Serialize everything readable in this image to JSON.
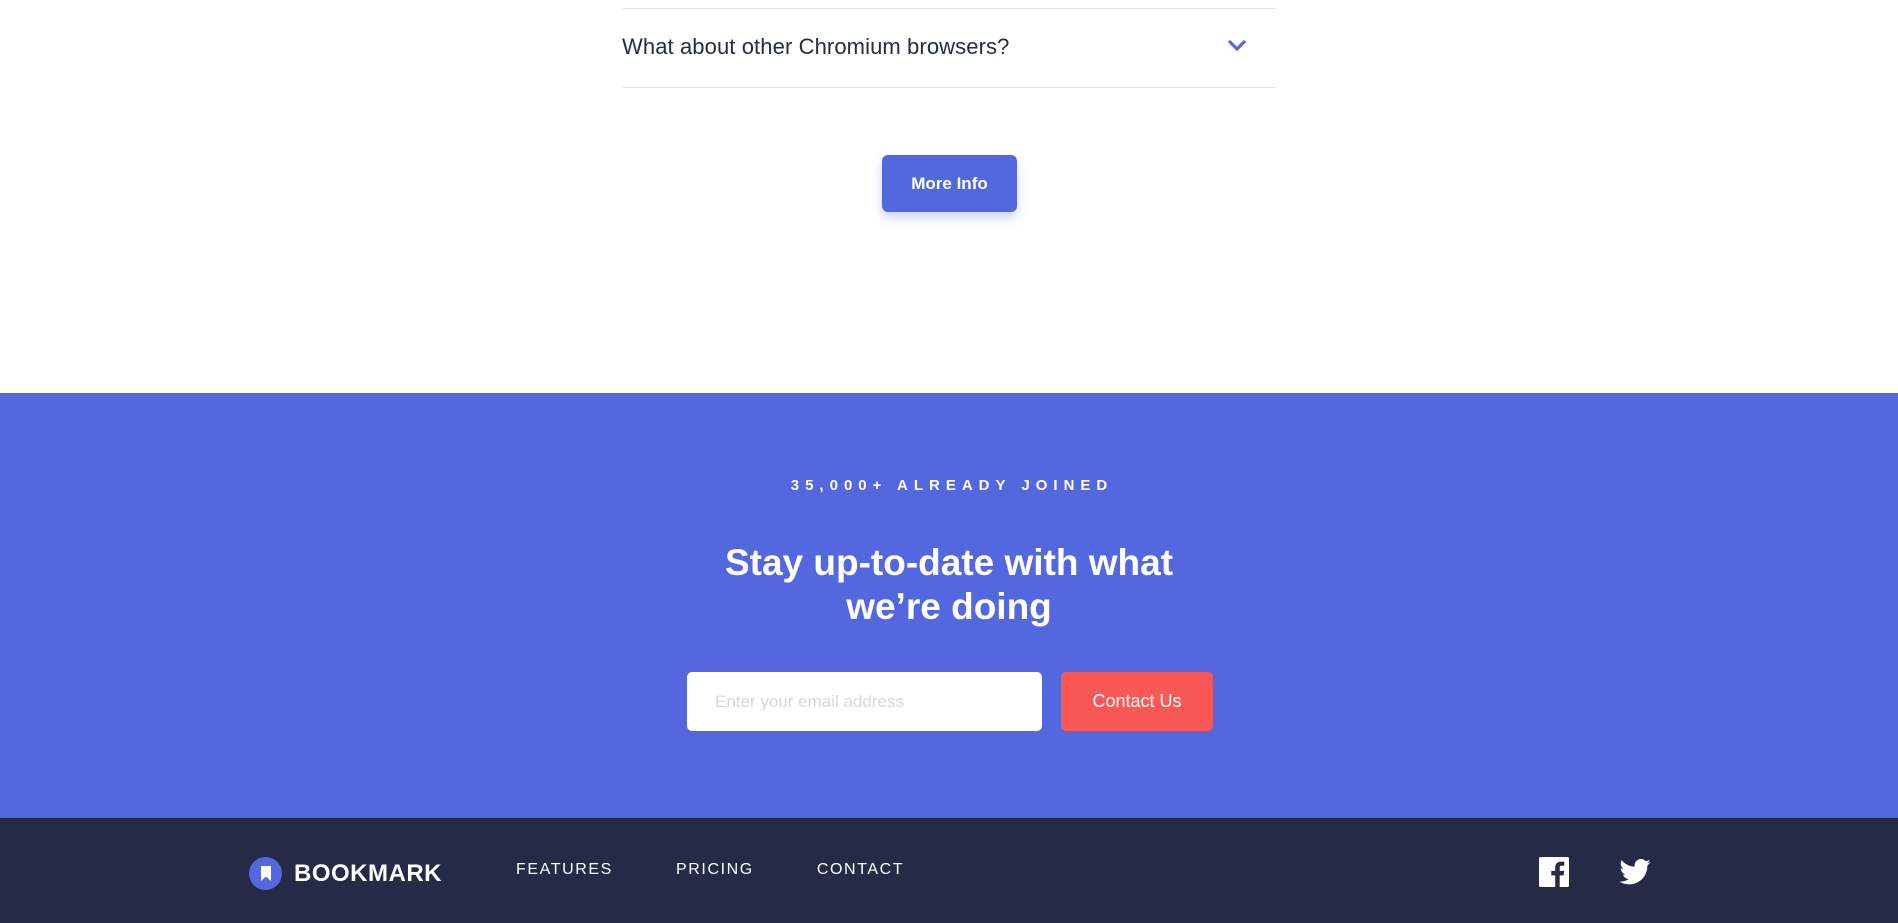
{
  "faq": {
    "question": "What about other Chromium browsers?",
    "more_info_label": "More Info"
  },
  "newsletter": {
    "kicker": "35,000+ ALREADY JOINED",
    "title": "Stay up-to-date with what we’re doing",
    "email_placeholder": "Enter your email address",
    "contact_label": "Contact Us"
  },
  "footer": {
    "logo_text": "BOOKMARK",
    "nav": [
      "FEATURES",
      "PRICING",
      "CONTACT"
    ],
    "social": [
      "facebook-icon",
      "twitter-icon"
    ]
  },
  "colors": {
    "primary_blue": "#5368df",
    "soft_red": "#fa5757",
    "dark_navy": "#252b46"
  }
}
